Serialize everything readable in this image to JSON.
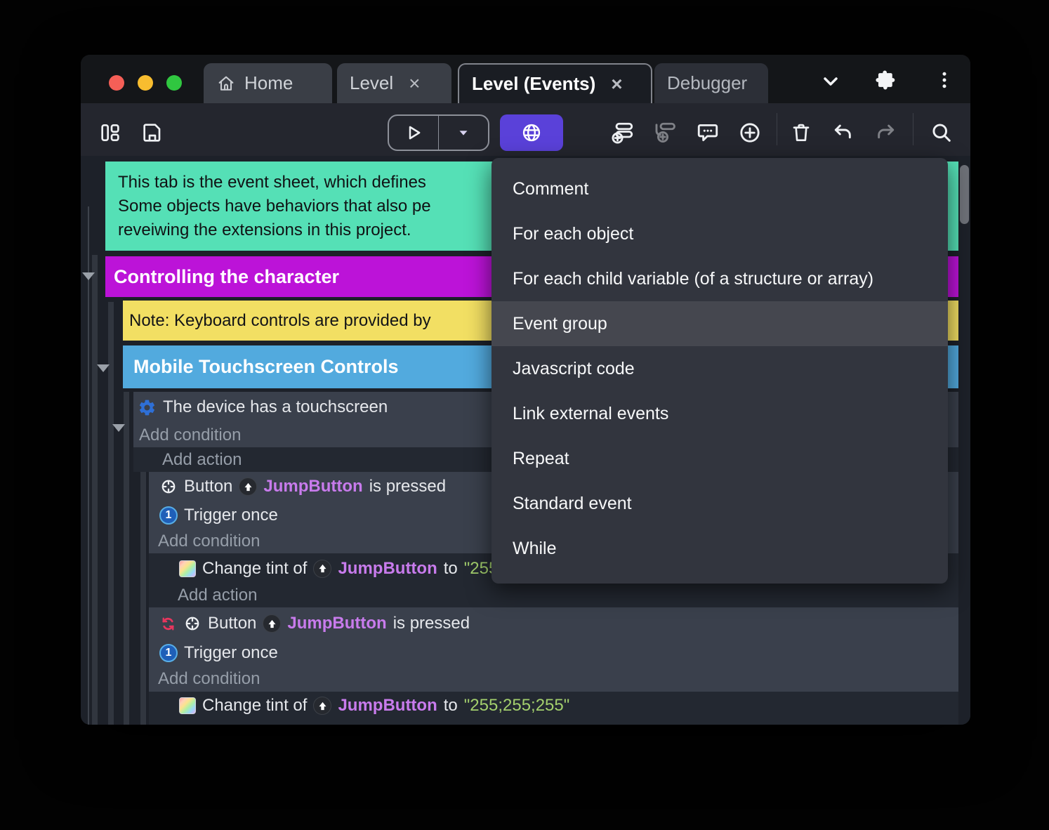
{
  "colors": {
    "accent_purple": "#5a41d9",
    "comment_green": "#55e0b6",
    "group_magenta": "#bc13d8",
    "note_yellow": "#f2df63",
    "subgroup_blue": "#52aade",
    "object_violet": "#c87bec",
    "string_green": "#a3cf6d"
  },
  "titlebar": {
    "tabs": {
      "home": "Home",
      "level": "Level",
      "level_events": "Level (Events)",
      "debugger": "Debugger"
    },
    "close_glyph": "×"
  },
  "toolbar": {
    "icons": [
      "project-manager-icon",
      "save-icon",
      "play-icon",
      "play-options-caret-icon",
      "preview-globe-icon",
      "add-event-icon",
      "add-subevent-icon",
      "add-comment-icon",
      "add-circle-icon",
      "delete-icon",
      "undo-icon",
      "redo-icon",
      "search-icon"
    ]
  },
  "menu": {
    "highlighted_item": "Event group",
    "items": [
      "Comment",
      "For each object",
      "For each child variable (of a structure or array)",
      "Event group",
      "Javascript code",
      "Link external events",
      "Repeat",
      "Standard event",
      "While"
    ]
  },
  "sheet": {
    "comment_lines": {
      "0": "This tab is the event sheet, which defines",
      "1": "Some objects have behaviors that also pe",
      "2": "reveiwing the extensions in this project."
    },
    "group_title": "Controlling the character",
    "note_text": "Note: Keyboard controls are provided by",
    "subgroup_title": "Mobile Touchscreen Controls",
    "add_condition": "Add condition",
    "add_action": "Add action",
    "touchscreen_condition": "The device has a touchscreen",
    "button_prefix": "Button",
    "object_name": "JumpButton",
    "pressed_suffix": "is pressed",
    "trigger_once": "Trigger once",
    "tint_prefix": "Change tint of",
    "to_word": "to",
    "tint_value": "\"255;255;255\""
  }
}
